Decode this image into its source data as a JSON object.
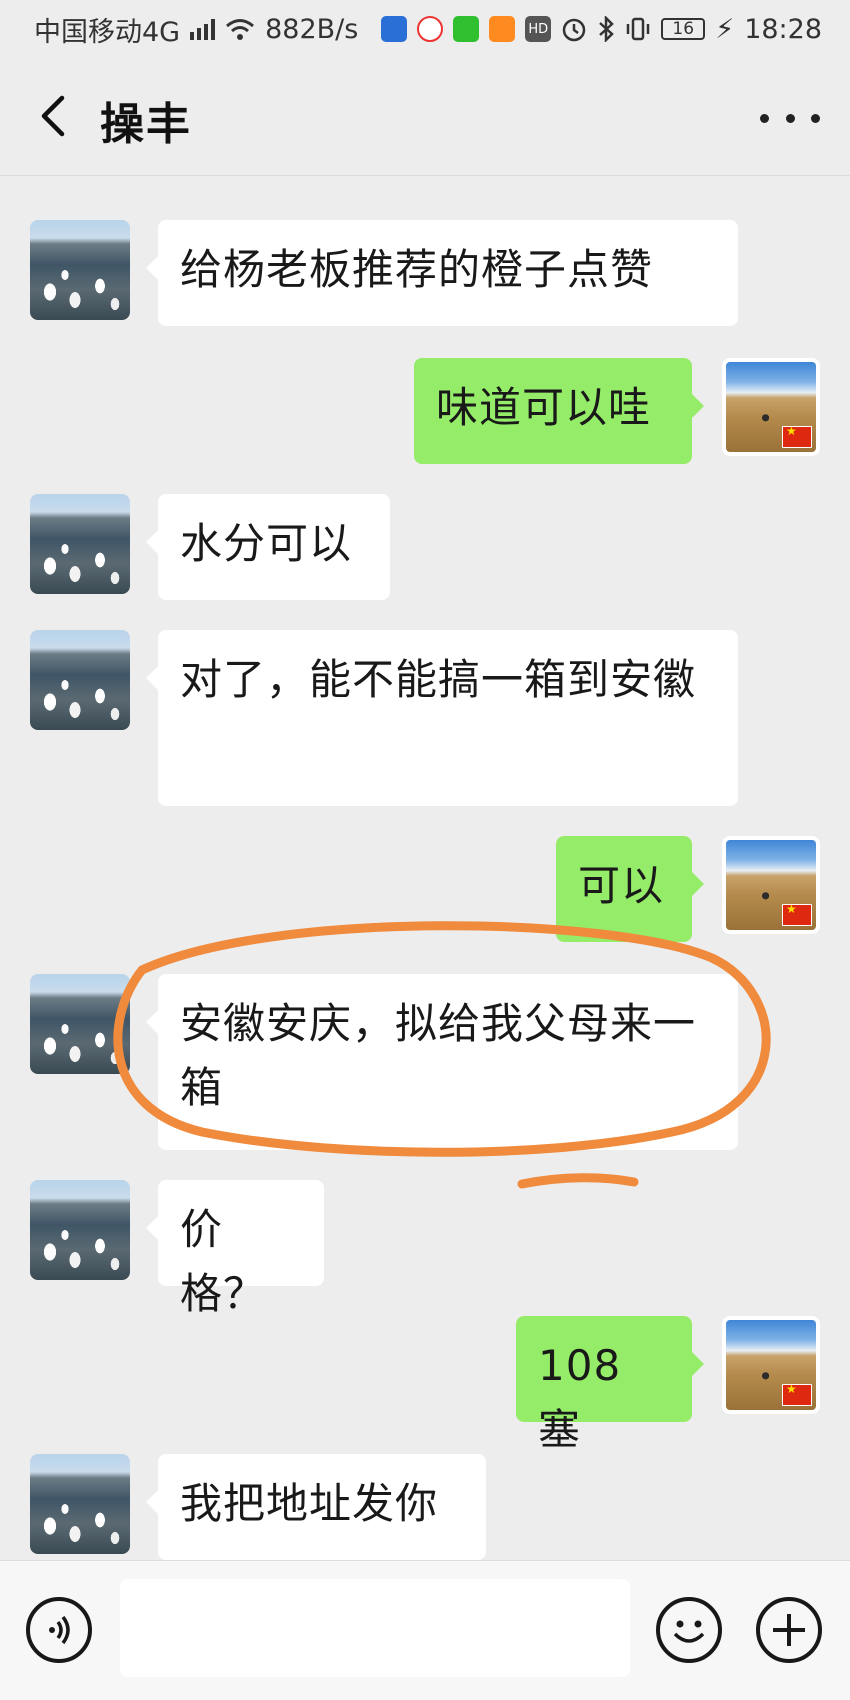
{
  "status_bar": {
    "carrier": "中国移动4G",
    "network_tag": "4G",
    "speed": "882B/s",
    "hd": "HD",
    "battery": "16",
    "time": "18:28",
    "icons": [
      "signal-icon",
      "wifi-icon",
      "app-icon-1",
      "app-icon-2",
      "iqiyi-icon",
      "video-icon",
      "hd-icon",
      "alarm-icon",
      "bluetooth-icon",
      "vibrate-icon",
      "battery-icon",
      "charging-icon"
    ]
  },
  "header": {
    "title": "操丰",
    "back_icon": "chevron-left-icon",
    "more_icon": "more-icon"
  },
  "messages": [
    {
      "side": "in",
      "text": "给杨老板推荐的橙子点赞"
    },
    {
      "side": "out",
      "text": "味道可以哇"
    },
    {
      "side": "in",
      "text": "水分可以"
    },
    {
      "side": "in",
      "text": "对了，能不能搞一箱到安徽"
    },
    {
      "side": "out",
      "text": "可以"
    },
    {
      "side": "in",
      "text": "安徽安庆，拟给我父母来一箱"
    },
    {
      "side": "in",
      "text": "价格？"
    },
    {
      "side": "out",
      "text": "108 塞"
    },
    {
      "side": "in",
      "text": "我把地址发你"
    }
  ],
  "annotation": {
    "color": "#f08a3c"
  },
  "input_bar": {
    "placeholder": "",
    "voice_icon": "voice-icon",
    "emoji_icon": "emoji-icon",
    "plus_icon": "plus-icon"
  },
  "colors": {
    "background": "#ededed",
    "bubble_out": "#95ec69",
    "bubble_in": "#ffffff"
  }
}
